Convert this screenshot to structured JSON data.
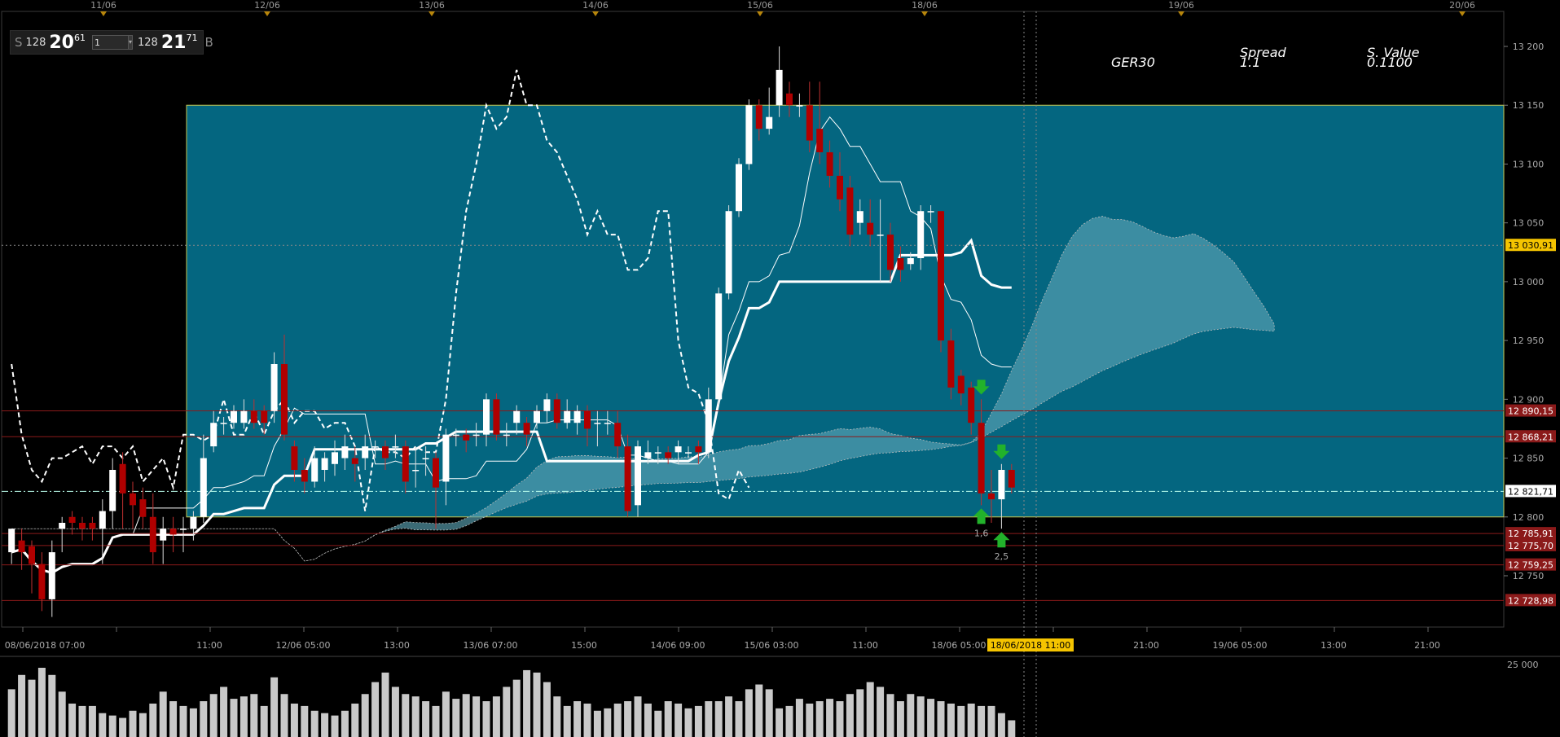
{
  "trade_panel": {
    "sell_label": "S",
    "sell_qty": "128",
    "sell_price_main": "20",
    "sell_price_sup": "61",
    "lot_value": "1",
    "buy_qty": "128",
    "buy_price_main": "21",
    "buy_price_sup": "71",
    "buy_label": "B"
  },
  "instrument": {
    "symbol": "GER30",
    "spread_label": "Spread",
    "spread_value": "1.1",
    "svalue_label": "S. Value",
    "svalue_value": "0.1100"
  },
  "chart_data": {
    "type": "candlestick",
    "title": "GER30",
    "top_date_labels": [
      "11/06",
      "12/06",
      "13/06",
      "14/06",
      "15/06",
      "18/06",
      "19/06",
      "20/06"
    ],
    "x_time_labels": [
      "08/06/2018 07:00",
      "11:00",
      "12/06 05:00",
      "13:00",
      "13/06 07:00",
      "15:00",
      "14/06 09:00",
      "15/06 03:00",
      "11:00",
      "18/06 05:00",
      "18/06/2018 11:00",
      "21:00",
      "19/06 05:00",
      "13:00",
      "21:00"
    ],
    "y_ticks": [
      12750,
      12800,
      12850,
      12900,
      12950,
      13000,
      13050,
      13100,
      13150,
      13200
    ],
    "y_tick_labels": [
      "12 750",
      "12 800",
      "12 850",
      "12 900",
      "12 950",
      "13 000",
      "13 050",
      "13 100",
      "13 150",
      "13 200"
    ],
    "ylim": [
      12700,
      13250
    ],
    "current_price": 12821.71,
    "current_price_label": "12 821,71",
    "crosshair_price_label": "13 030,91",
    "level_labels": [
      {
        "label": "12 890,15",
        "value": 12890.15
      },
      {
        "label": "12 868,21",
        "value": 12868.21
      },
      {
        "label": "12 785,91",
        "value": 12785.91
      },
      {
        "label": "12 775,70",
        "value": 12775.7
      },
      {
        "label": "12 759,25",
        "value": 12759.25
      },
      {
        "label": "12 728,98",
        "value": 12728.98
      }
    ],
    "box": {
      "from_bar": 20,
      "to_bar": 999,
      "top": 13150,
      "bottom": 12800
    },
    "candles": [
      [
        12770,
        12790,
        12760,
        12780
      ],
      [
        12780,
        12770,
        12755,
        12790
      ],
      [
        12775,
        12760,
        12735,
        12780
      ],
      [
        12760,
        12730,
        12720,
        12770
      ],
      [
        12730,
        12770,
        12715,
        12780
      ],
      [
        12790,
        12795,
        12770,
        12800
      ],
      [
        12800,
        12795,
        12785,
        12805
      ],
      [
        12795,
        12790,
        12780,
        12800
      ],
      [
        12795,
        12790,
        12780,
        12800
      ],
      [
        12790,
        12805,
        12760,
        12815
      ],
      [
        12805,
        12840,
        12790,
        12850
      ],
      [
        12845,
        12820,
        12790,
        12855
      ],
      [
        12820,
        12810,
        12790,
        12830
      ],
      [
        12815,
        12800,
        12790,
        12825
      ],
      [
        12800,
        12770,
        12760,
        12820
      ],
      [
        12780,
        12790,
        12760,
        12800
      ],
      [
        12790,
        12785,
        12770,
        12800
      ],
      [
        12790,
        12790,
        12770,
        12800
      ],
      [
        12790,
        12800,
        12780,
        12805
      ],
      [
        12800,
        12850,
        12795,
        12870
      ],
      [
        12860,
        12880,
        12855,
        12890
      ],
      [
        12880,
        12880,
        12870,
        12885
      ],
      [
        12880,
        12890,
        12875,
        12895
      ],
      [
        12880,
        12890,
        12875,
        12900
      ],
      [
        12890,
        12880,
        12875,
        12900
      ],
      [
        12890,
        12880,
        12870,
        12895
      ],
      [
        12890,
        12930,
        12880,
        12940
      ],
      [
        12930,
        12870,
        12865,
        12955
      ],
      [
        12860,
        12840,
        12830,
        12865
      ],
      [
        12840,
        12830,
        12820,
        12850
      ],
      [
        12830,
        12850,
        12825,
        12860
      ],
      [
        12840,
        12850,
        12830,
        12855
      ],
      [
        12845,
        12855,
        12835,
        12865
      ],
      [
        12850,
        12860,
        12840,
        12870
      ],
      [
        12850,
        12845,
        12830,
        12860
      ],
      [
        12850,
        12860,
        12840,
        12870
      ],
      [
        12860,
        12860,
        12850,
        12865
      ],
      [
        12860,
        12850,
        12840,
        12865
      ],
      [
        12860,
        12860,
        12850,
        12870
      ],
      [
        12860,
        12830,
        12820,
        12865
      ],
      [
        12840,
        12840,
        12825,
        12860
      ],
      [
        12850,
        12850,
        12835,
        12860
      ],
      [
        12850,
        12825,
        12790,
        12855
      ],
      [
        12830,
        12870,
        12810,
        12875
      ],
      [
        12870,
        12870,
        12860,
        12875
      ],
      [
        12870,
        12865,
        12855,
        12875
      ],
      [
        12870,
        12870,
        12860,
        12880
      ],
      [
        12870,
        12900,
        12860,
        12905
      ],
      [
        12900,
        12870,
        12865,
        12905
      ],
      [
        12870,
        12870,
        12860,
        12880
      ],
      [
        12880,
        12890,
        12870,
        12895
      ],
      [
        12880,
        12870,
        12860,
        12885
      ],
      [
        12880,
        12890,
        12875,
        12895
      ],
      [
        12890,
        12900,
        12880,
        12905
      ],
      [
        12900,
        12880,
        12875,
        12905
      ],
      [
        12880,
        12890,
        12875,
        12900
      ],
      [
        12880,
        12890,
        12870,
        12895
      ],
      [
        12890,
        12875,
        12860,
        12895
      ],
      [
        12880,
        12880,
        12860,
        12890
      ],
      [
        12880,
        12880,
        12870,
        12890
      ],
      [
        12880,
        12860,
        12850,
        12890
      ],
      [
        12860,
        12805,
        12800,
        12870
      ],
      [
        12810,
        12860,
        12800,
        12865
      ],
      [
        12850,
        12855,
        12845,
        12865
      ],
      [
        12855,
        12855,
        12845,
        12860
      ],
      [
        12855,
        12850,
        12845,
        12860
      ],
      [
        12855,
        12860,
        12845,
        12865
      ],
      [
        12855,
        12855,
        12850,
        12860
      ],
      [
        12860,
        12855,
        12845,
        12865
      ],
      [
        12855,
        12900,
        12850,
        12910
      ],
      [
        12900,
        12990,
        12895,
        12995
      ],
      [
        12990,
        13060,
        12985,
        13065
      ],
      [
        13060,
        13100,
        13055,
        13105
      ],
      [
        13100,
        13150,
        13095,
        13155
      ],
      [
        13150,
        13130,
        13120,
        13155
      ],
      [
        13130,
        13140,
        13125,
        13165
      ],
      [
        13150,
        13180,
        13140,
        13200
      ],
      [
        13160,
        13150,
        13140,
        13170
      ],
      [
        13150,
        13150,
        13140,
        13160
      ],
      [
        13150,
        13120,
        13110,
        13170
      ],
      [
        13130,
        13110,
        13100,
        13170
      ],
      [
        13110,
        13090,
        13080,
        13120
      ],
      [
        13090,
        13070,
        13060,
        13110
      ],
      [
        13080,
        13040,
        13030,
        13090
      ],
      [
        13050,
        13060,
        13040,
        13070
      ],
      [
        13050,
        13040,
        13030,
        13070
      ],
      [
        13040,
        13040,
        13000,
        13070
      ],
      [
        13040,
        13010,
        13000,
        13050
      ],
      [
        13020,
        13010,
        13000,
        13030
      ],
      [
        13015,
        13020,
        13010,
        13025
      ],
      [
        13020,
        13060,
        13010,
        13065
      ],
      [
        13060,
        13060,
        13050,
        13065
      ],
      [
        13060,
        12950,
        12940,
        13060
      ],
      [
        12950,
        12910,
        12900,
        12960
      ],
      [
        12920,
        12905,
        12895,
        12925
      ],
      [
        12910,
        12880,
        12870,
        12915
      ],
      [
        12880,
        12820,
        12810,
        12900
      ],
      [
        12820,
        12815,
        12795,
        12840
      ],
      [
        12815,
        12840,
        12790,
        12845
      ],
      [
        12840,
        12825,
        12820,
        12845
      ]
    ],
    "volume": [
      40,
      52,
      48,
      58,
      52,
      38,
      28,
      26,
      26,
      20,
      18,
      16,
      22,
      20,
      28,
      38,
      30,
      26,
      24,
      30,
      36,
      42,
      32,
      34,
      36,
      26,
      50,
      36,
      28,
      26,
      22,
      20,
      18,
      22,
      28,
      36,
      46,
      54,
      42,
      36,
      34,
      30,
      26,
      38,
      32,
      36,
      34,
      30,
      34,
      42,
      48,
      56,
      54,
      46,
      34,
      26,
      30,
      28,
      22,
      24,
      28,
      30,
      34,
      28,
      22,
      30,
      28,
      24,
      26,
      30,
      30,
      34,
      30,
      40,
      44,
      40,
      24,
      26,
      32,
      28,
      30,
      32,
      30,
      36,
      40,
      46,
      42,
      36,
      30,
      36,
      34,
      32,
      30,
      28,
      26,
      28,
      26,
      26,
      20,
      14
    ],
    "volume_axis_label": "25 000",
    "signals": [
      {
        "type": "sell-arrow",
        "bar": 96
      },
      {
        "type": "sell-arrow",
        "bar": 98
      },
      {
        "type": "buy-arrow",
        "bar": 96,
        "label": "1,6"
      },
      {
        "type": "buy-arrow",
        "bar": 98,
        "label": "2,5"
      }
    ]
  }
}
